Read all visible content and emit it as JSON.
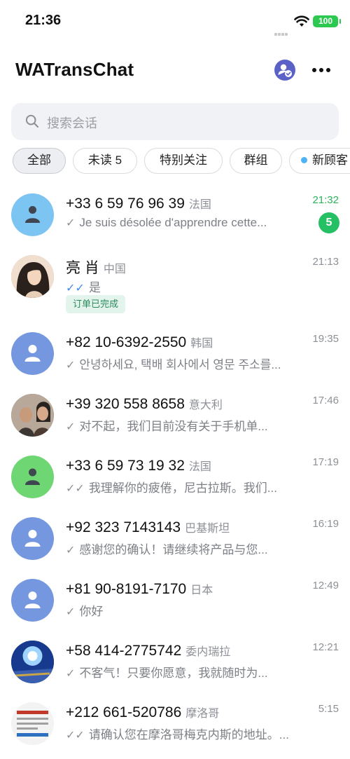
{
  "status_bar": {
    "time": "21:36",
    "battery": "100"
  },
  "header": {
    "title": "WATransChat",
    "contact_icon": "contact-verified-icon",
    "more_icon": "more-horizontal-icon"
  },
  "search": {
    "placeholder": "搜索会话",
    "icon": "search-icon"
  },
  "filters": [
    {
      "label": "全部"
    },
    {
      "label": "未读 5"
    },
    {
      "label": "特别关注"
    },
    {
      "label": "群组"
    },
    {
      "label": "新顾客"
    }
  ],
  "colors": {
    "accent_green": "#25c064",
    "read_check_blue": "#3d8bf2",
    "avatar_blue": "#7597e0"
  },
  "chats": [
    {
      "name": "+33 6 59 76 96 39",
      "country": "法国",
      "check": "✓",
      "message": "Je suis désolée d'apprendre cette...",
      "time": "21:32",
      "unread": "5"
    },
    {
      "name": "亮 肖",
      "country": "中国",
      "check": "✓✓",
      "message": "是",
      "time": "21:13",
      "tag": "订单已完成"
    },
    {
      "name": "+82 10-6392-2550",
      "country": "韩国",
      "check": "✓",
      "message": "안녕하세요, 택배 회사에서 영문 주소를...",
      "time": "19:35"
    },
    {
      "name": "+39 320 558 8658",
      "country": "意大利",
      "check": "✓",
      "message": "对不起，我们目前没有关于手机单...",
      "time": "17:46"
    },
    {
      "name": "+33 6 59 73 19 32",
      "country": "法国",
      "check": "✓✓",
      "message": "我理解你的疲倦，尼古拉斯。我们...",
      "time": "17:19"
    },
    {
      "name": "+92 323 7143143",
      "country": "巴基斯坦",
      "check": "✓",
      "message": "感谢您的确认！请继续将产品与您...",
      "time": "16:19"
    },
    {
      "name": "+81 90-8191-7170",
      "country": "日本",
      "check": "✓",
      "message": "你好",
      "time": "12:49"
    },
    {
      "name": "+58 414-2775742",
      "country": "委内瑞拉",
      "check": "✓",
      "message": "不客气！只要你愿意，我就随时为...",
      "time": "12:21"
    },
    {
      "name": "+212 661-520786",
      "country": "摩洛哥",
      "check": "✓✓",
      "message": "请确认您在摩洛哥梅克内斯的地址。...",
      "time": "5:15"
    }
  ]
}
